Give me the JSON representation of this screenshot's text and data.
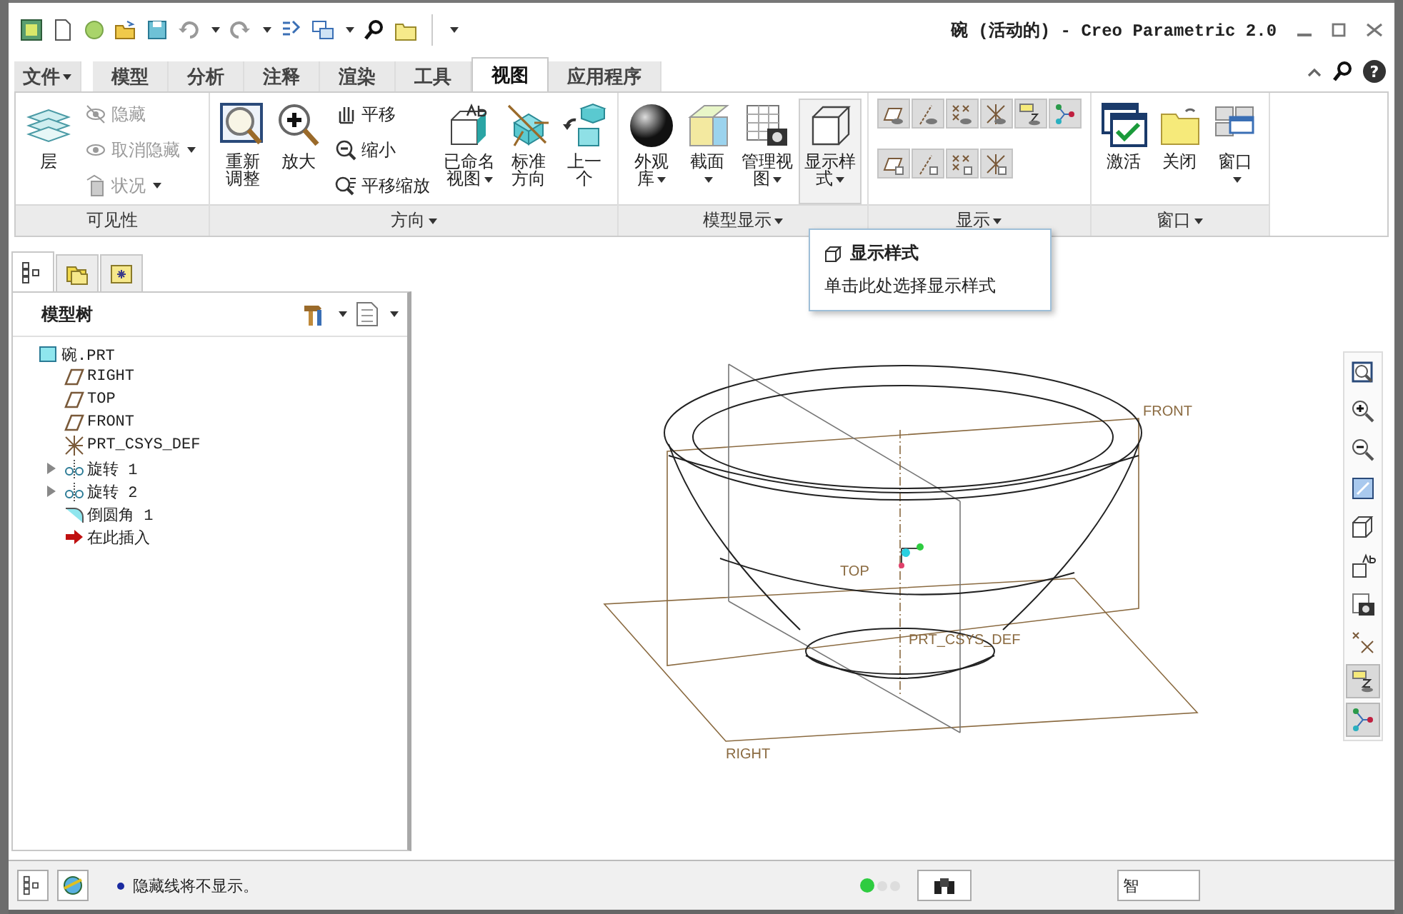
{
  "window": {
    "title": "碗 (活动的) - Creo Parametric 2.0"
  },
  "ribbon_tabs": [
    {
      "label": "文件",
      "kind": "menu",
      "selected": false
    },
    {
      "label": "模型",
      "kind": "tab",
      "selected": false
    },
    {
      "label": "分析",
      "kind": "tab",
      "selected": false
    },
    {
      "label": "注释",
      "kind": "tab",
      "selected": false
    },
    {
      "label": "渲染",
      "kind": "tab",
      "selected": false
    },
    {
      "label": "工具",
      "kind": "tab",
      "selected": false
    },
    {
      "label": "视图",
      "kind": "tab",
      "selected": true
    },
    {
      "label": "应用程序",
      "kind": "tab",
      "selected": false
    }
  ],
  "ribbon_groups": [
    {
      "title": "可见性",
      "has_menu": false,
      "items": [
        {
          "kind": "large",
          "label": "层",
          "has_menu": false,
          "hovered": false
        },
        {
          "kind": "stack",
          "items": [
            {
              "label": "隐藏",
              "disabled": true,
              "has_menu": false
            },
            {
              "label": "取消隐藏",
              "disabled": true,
              "has_menu": true
            },
            {
              "label": "状况",
              "disabled": true,
              "has_menu": true
            }
          ]
        }
      ]
    },
    {
      "title": "方向",
      "has_menu": true,
      "items": [
        {
          "kind": "large",
          "label": "重新调整",
          "has_menu": false,
          "hovered": false
        },
        {
          "kind": "large",
          "label": "放大",
          "has_menu": false,
          "hovered": false
        },
        {
          "kind": "stack",
          "items": [
            {
              "label": "平移",
              "disabled": false,
              "has_menu": false
            },
            {
              "label": "缩小",
              "disabled": false,
              "has_menu": false
            },
            {
              "label": "平移缩放",
              "disabled": false,
              "has_menu": false
            }
          ]
        },
        {
          "kind": "large",
          "label": "已命名视图",
          "has_menu": true,
          "hovered": false
        },
        {
          "kind": "large",
          "label": "标准方向",
          "has_menu": false,
          "hovered": false
        },
        {
          "kind": "large",
          "label": "上一个",
          "has_menu": false,
          "hovered": false
        }
      ]
    },
    {
      "title": "模型显示",
      "has_menu": true,
      "items": [
        {
          "kind": "large",
          "label": "外观库",
          "has_menu": true,
          "hovered": false
        },
        {
          "kind": "large",
          "label": "截面",
          "has_menu": true,
          "hovered": false
        },
        {
          "kind": "large",
          "label": "管理视图",
          "has_menu": true,
          "hovered": false
        },
        {
          "kind": "large",
          "label": "显示样式",
          "has_menu": true,
          "hovered": true
        }
      ]
    },
    {
      "title": "显示",
      "has_menu": true,
      "items": [
        {
          "kind": "toggles",
          "rows": [
            [
              {
                "on": true
              },
              {
                "on": true
              },
              {
                "on": true
              },
              {
                "on": true
              },
              {
                "on": true
              },
              {
                "on": true
              }
            ],
            [
              {
                "on": true
              },
              {
                "on": true
              },
              {
                "on": true
              },
              {
                "on": true
              }
            ]
          ]
        }
      ]
    },
    {
      "title": "窗口",
      "has_menu": true,
      "items": [
        {
          "kind": "large",
          "label": "激活",
          "has_menu": false,
          "hovered": false
        },
        {
          "kind": "large",
          "label": "关闭",
          "has_menu": false,
          "hovered": false
        },
        {
          "kind": "large",
          "label": "窗口",
          "has_menu": true,
          "hovered": false
        }
      ]
    }
  ],
  "help_button": {
    "label": "?"
  },
  "tooltip": {
    "title": "显示样式",
    "text": "单击此处选择显示样式"
  },
  "navigator_tabs": [
    {
      "selected": true
    },
    {
      "selected": false
    },
    {
      "selected": false
    }
  ],
  "model_tree": {
    "title": "模型树",
    "items": [
      {
        "label": "碗.PRT",
        "kind": "part",
        "children": [
          {
            "label": "RIGHT",
            "kind": "plane"
          },
          {
            "label": "TOP",
            "kind": "plane"
          },
          {
            "label": "FRONT",
            "kind": "plane"
          },
          {
            "label": "PRT_CSYS_DEF",
            "kind": "csys"
          },
          {
            "label": "旋转 1",
            "kind": "revolve",
            "expanded": false
          },
          {
            "label": "旋转 2",
            "kind": "revolve",
            "expanded": false
          },
          {
            "label": "倒圆角 1",
            "kind": "round"
          },
          {
            "label": "在此插入",
            "kind": "insert"
          }
        ]
      }
    ]
  },
  "datum_labels": [
    "FRONT",
    "TOP",
    "PRT_CSYS_DEF",
    "RIGHT"
  ],
  "view_toolbar": [
    {
      "pressed": false
    },
    {
      "pressed": false
    },
    {
      "pressed": false
    },
    {
      "pressed": false
    },
    {
      "pressed": false
    },
    {
      "pressed": false
    },
    {
      "pressed": false
    },
    {
      "pressed": false
    },
    {
      "pressed": true
    },
    {
      "pressed": true
    }
  ],
  "status_bar": {
    "message": "隐藏线将不显示。",
    "lights": [
      {
        "on": true
      },
      {
        "on": false
      },
      {
        "on": false
      }
    ],
    "filter": "智"
  }
}
